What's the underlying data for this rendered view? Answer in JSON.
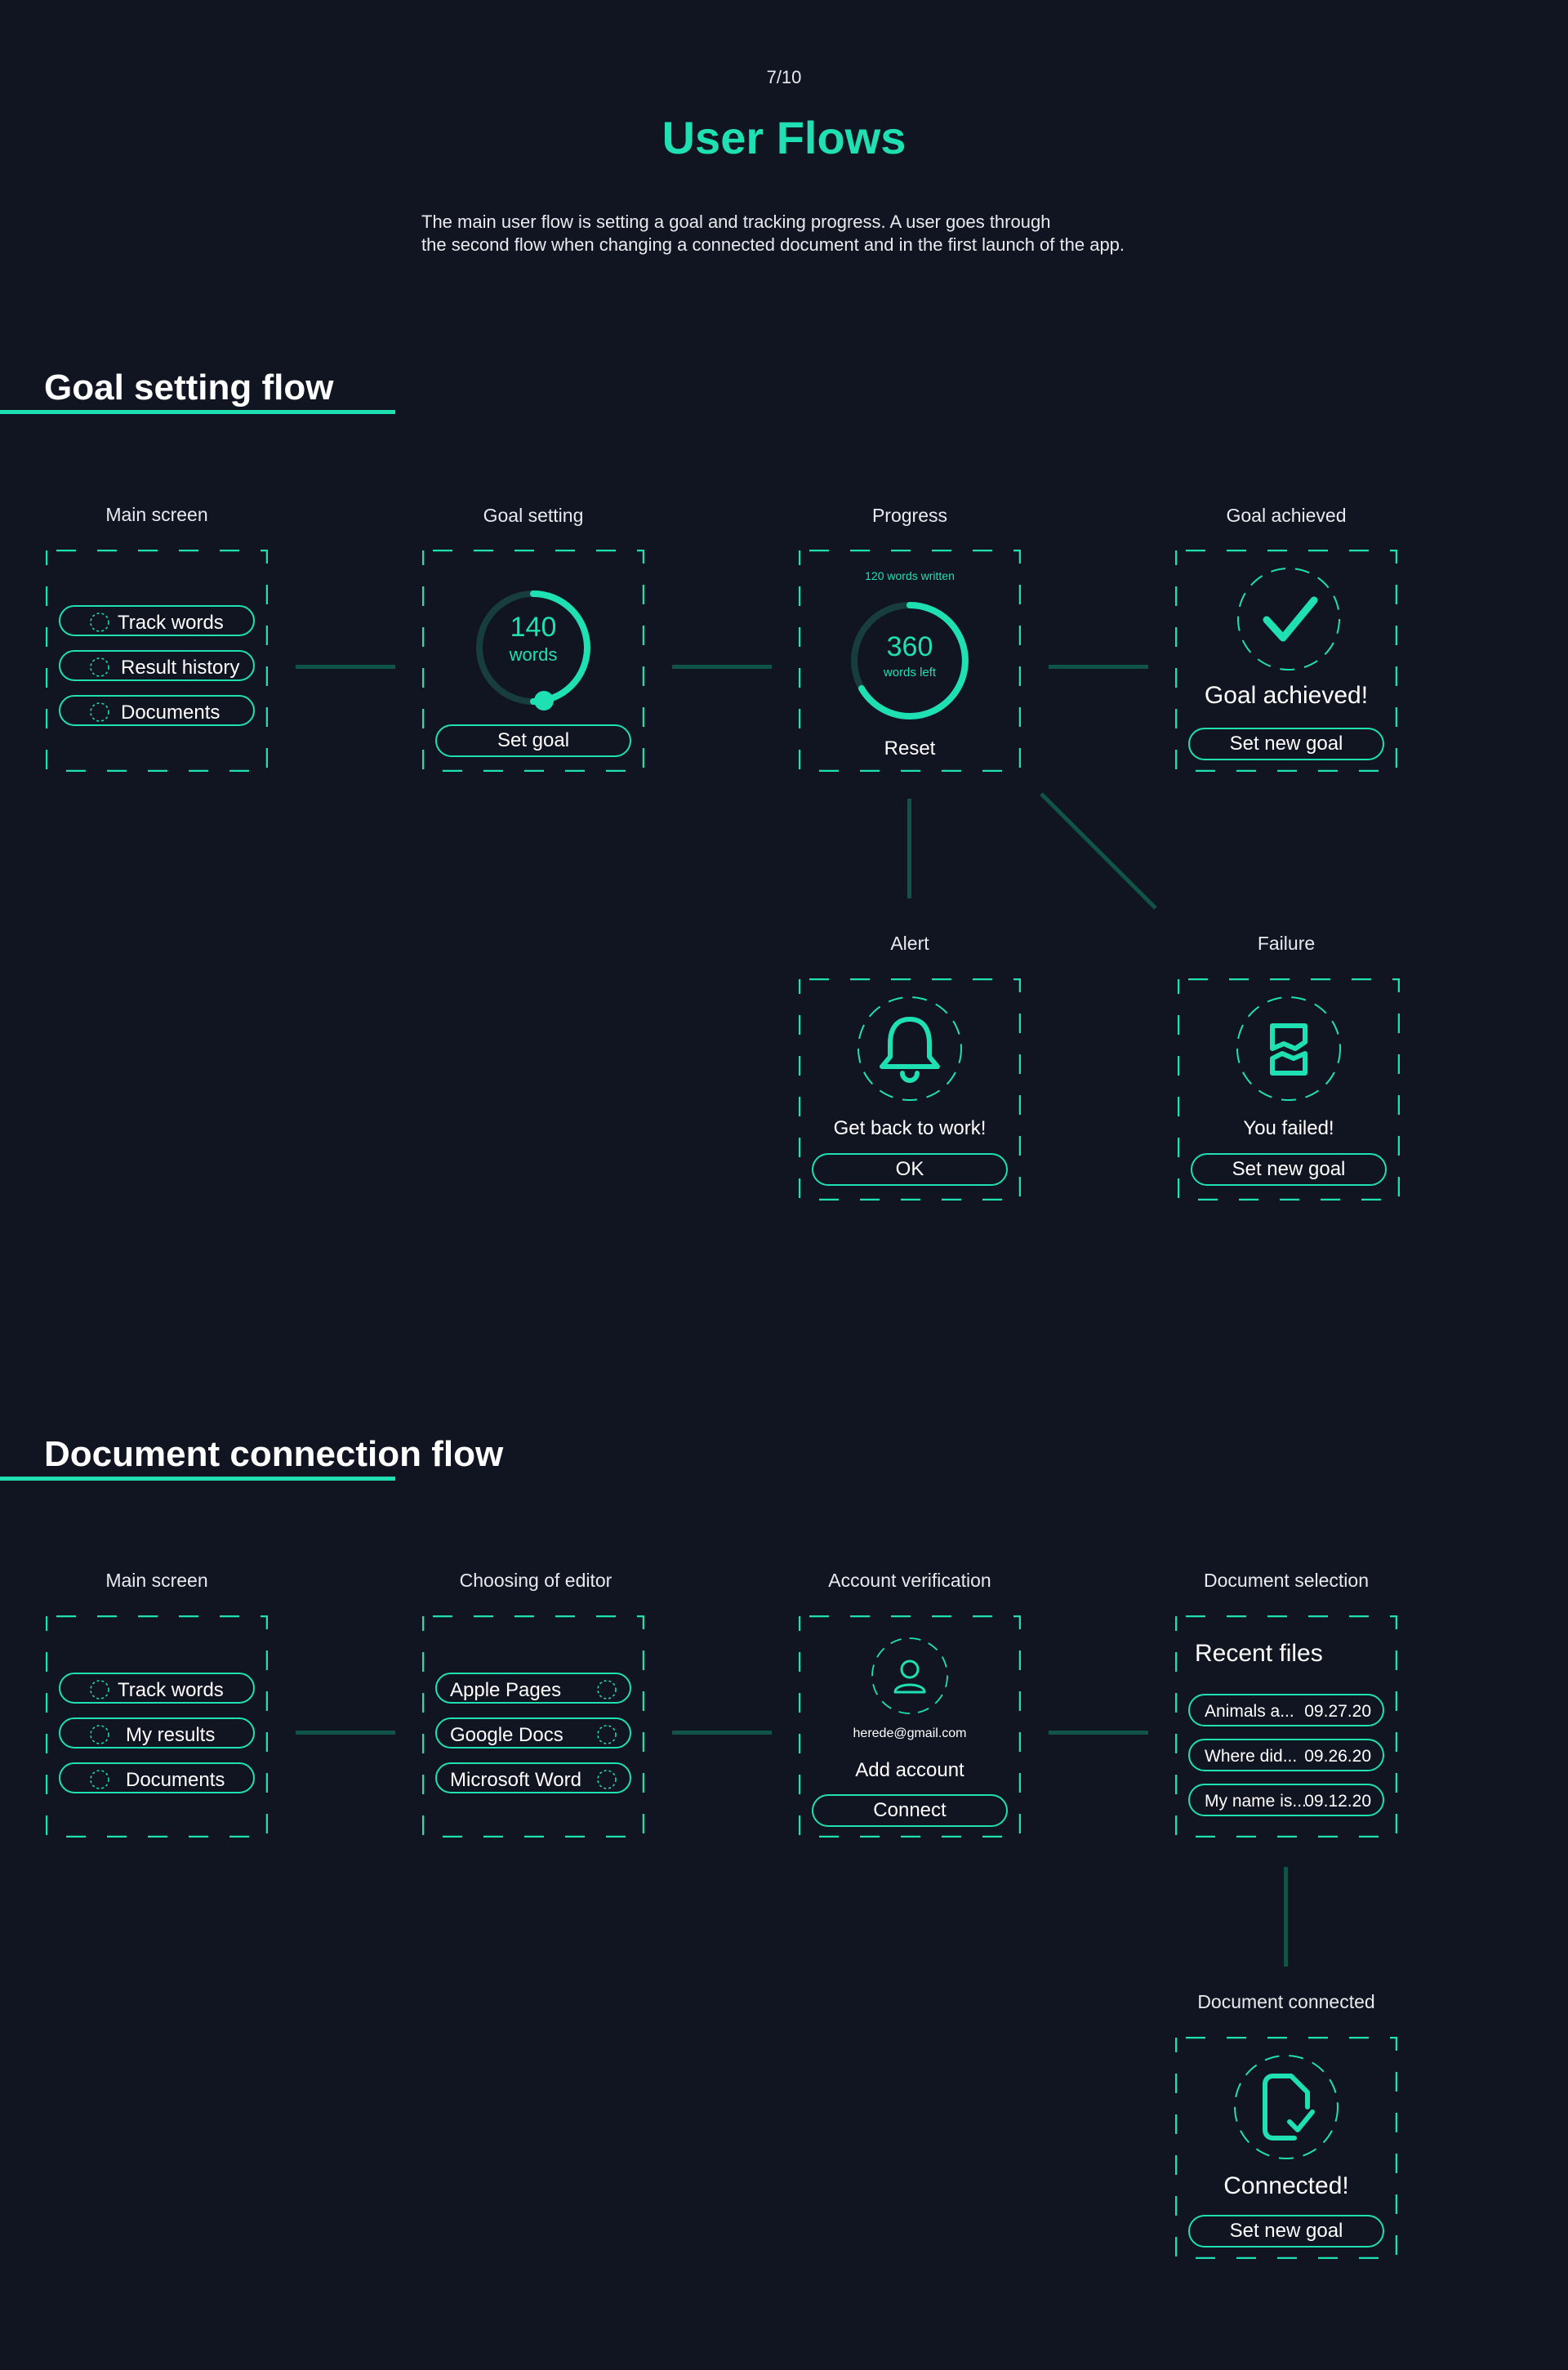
{
  "header": {
    "page_indicator": "7/10",
    "title": "User Flows",
    "intro_line1": "The main user flow is setting a goal and tracking progress. A user goes through",
    "intro_line2": "the second flow when changing a connected document and in the first launch of the app."
  },
  "colors": {
    "background": "#111521",
    "accent": "#1ee0b2",
    "connector": "#0f5446",
    "text": "#ffffff"
  },
  "goal_flow": {
    "title": "Goal setting flow",
    "main_screen": {
      "caption": "Main screen",
      "items": [
        "Track words",
        "Result history",
        "Documents"
      ]
    },
    "goal_setting": {
      "caption": "Goal setting",
      "value": "140",
      "unit": "words",
      "button": "Set goal"
    },
    "progress": {
      "caption": "Progress",
      "written": "120 words written",
      "value": "360",
      "unit": "words left",
      "button": "Reset"
    },
    "goal_achieved": {
      "caption": "Goal achieved",
      "icon": "checkmark-icon",
      "message": "Goal achieved!",
      "button": "Set new goal"
    },
    "alert": {
      "caption": "Alert",
      "icon": "bell-icon",
      "message": "Get back to work!",
      "button": "OK"
    },
    "failure": {
      "caption": "Failure",
      "icon": "broken-hourglass-icon",
      "message": "You failed!",
      "button": "Set new goal"
    }
  },
  "doc_flow": {
    "title": "Document connection flow",
    "main_screen": {
      "caption": "Main screen",
      "items": [
        "Track words",
        "My results",
        "Documents"
      ]
    },
    "editor": {
      "caption": "Choosing of editor",
      "items": [
        "Apple Pages",
        "Google Docs",
        "Microsoft Word"
      ]
    },
    "account": {
      "caption": "Account verification",
      "icon": "user-icon",
      "email": "herede@gmail.com",
      "add": "Add account",
      "button": "Connect"
    },
    "selection": {
      "caption": "Document selection",
      "heading": "Recent files",
      "files": [
        {
          "name": "Animals a...",
          "date": "09.27.20"
        },
        {
          "name": "Where did...",
          "date": "09.26.20"
        },
        {
          "name": "My name is...",
          "date": "09.12.20"
        }
      ]
    },
    "connected": {
      "caption": "Document connected",
      "icon": "document-check-icon",
      "message": "Connected!",
      "button": "Set new goal"
    }
  }
}
